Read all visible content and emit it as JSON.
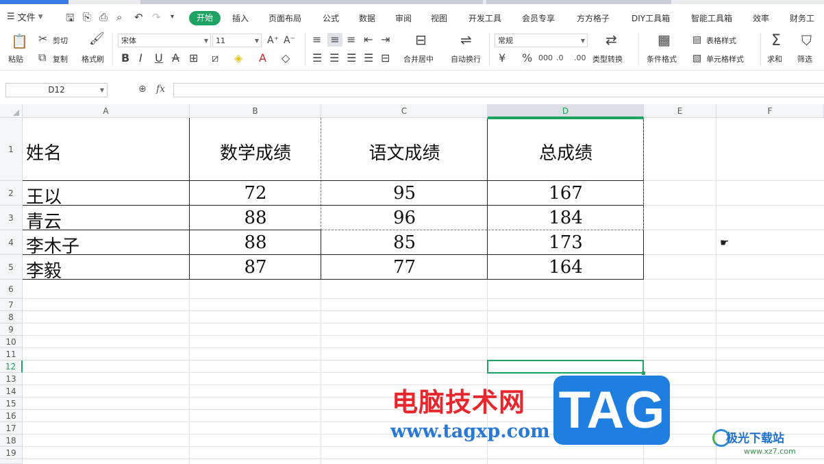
{
  "menu": {
    "file_label": "文件",
    "tabs": [
      "开始",
      "插入",
      "页面布局",
      "公式",
      "数据",
      "审阅",
      "视图",
      "开发工具",
      "会员专享",
      "方方格子",
      "DIY工具箱",
      "智能工具箱",
      "效率",
      "财务工"
    ]
  },
  "ribbon": {
    "paste": "粘贴",
    "cut": "剪切",
    "copy": "复制",
    "format_painter": "格式刷",
    "font_name": "宋体",
    "font_size": "11",
    "merge_center": "合并居中",
    "wrap_text": "自动换行",
    "number_format": "常规",
    "type_convert": "类型转换",
    "conditional_format": "条件格式",
    "table_style": "表格样式",
    "cell_style": "单元格样式",
    "sum": "求和",
    "filter": "筛选"
  },
  "formula_bar": {
    "name_box": "D12",
    "fx": "fx",
    "value": ""
  },
  "columns": [
    "A",
    "B",
    "C",
    "D",
    "E",
    "F"
  ],
  "rows": [
    "1",
    "2",
    "3",
    "4",
    "5",
    "6",
    "7",
    "8",
    "9",
    "10",
    "11",
    "12",
    "13",
    "14",
    "15",
    "16",
    "17",
    "18",
    "19"
  ],
  "table": {
    "headers": [
      "姓名",
      "数学成绩",
      "语文成绩",
      "总成绩"
    ],
    "data": [
      [
        "王以",
        "72",
        "95",
        "167"
      ],
      [
        "青云",
        "88",
        "96",
        "184"
      ],
      [
        "李木子",
        "88",
        "85",
        "173"
      ],
      [
        "李毅",
        "87",
        "77",
        "164"
      ]
    ]
  },
  "watermark": {
    "cn": "电脑技术网",
    "url": "www.tagxp.com",
    "tag": "TAG",
    "site2": "极光下载站",
    "site2_url": "www.xz7.com"
  }
}
